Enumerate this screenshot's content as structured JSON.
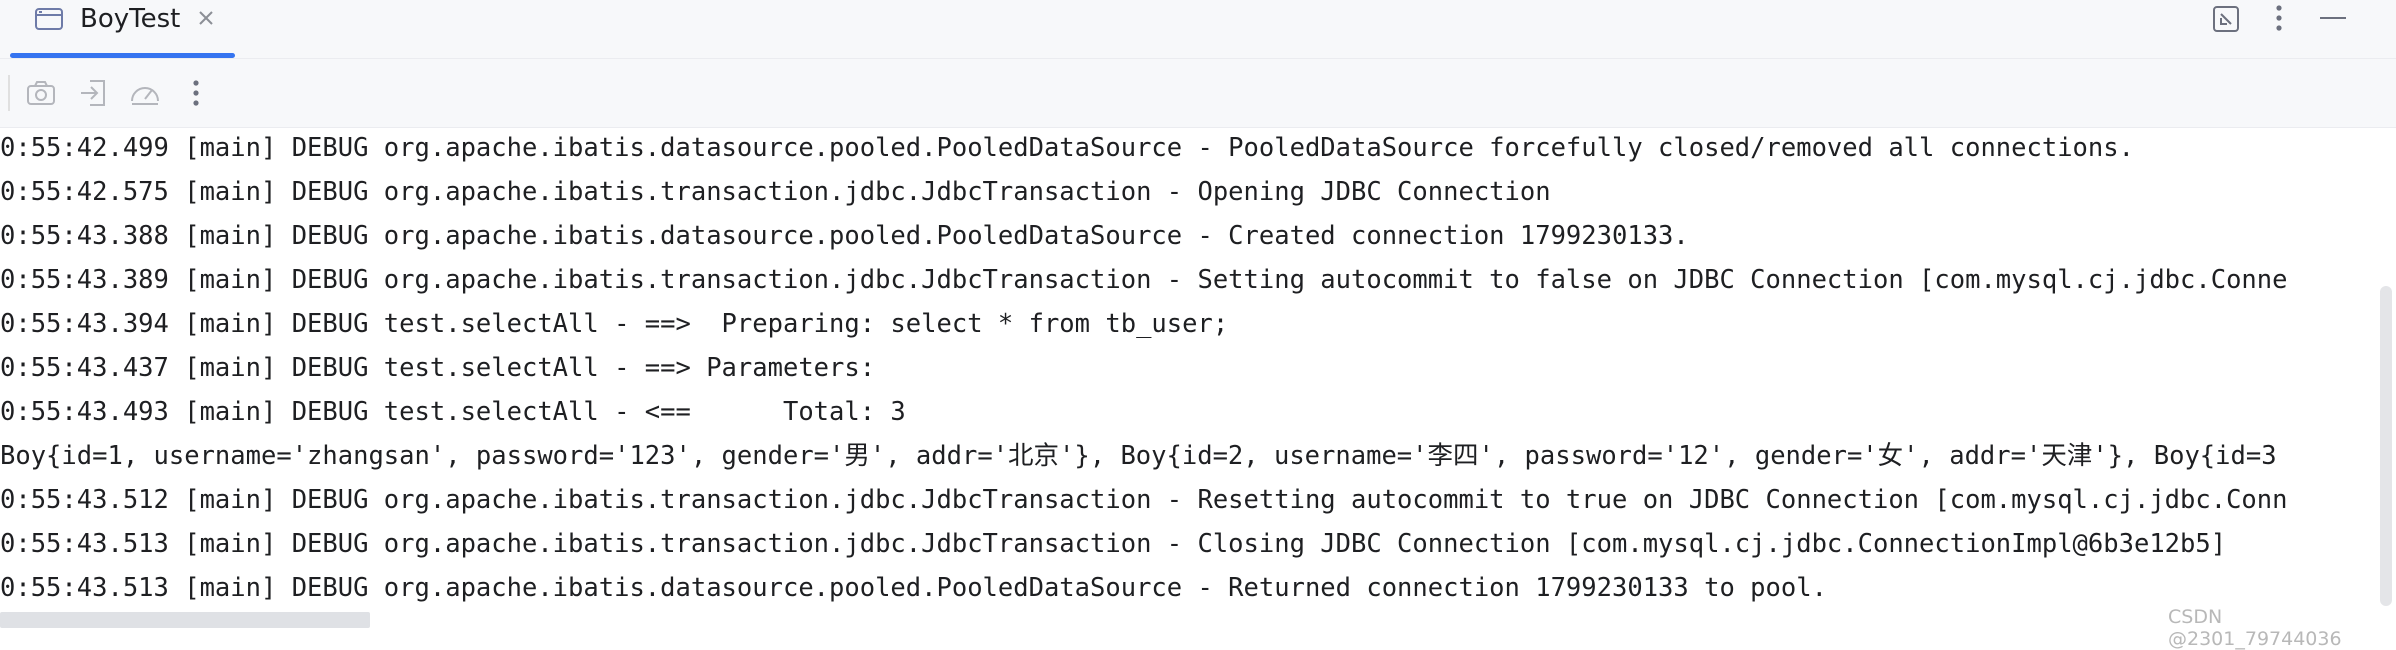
{
  "tab": {
    "title": "BoyTest"
  },
  "window_controls": [
    "restore-icon",
    "more-vertical-icon",
    "minimize-icon"
  ],
  "toolbar": {
    "icons": [
      "camera-icon",
      "import-icon",
      "gauge-icon",
      "more-vertical-icon"
    ]
  },
  "console": {
    "lines": [
      "0:55:42.499 [main] DEBUG org.apache.ibatis.datasource.pooled.PooledDataSource - PooledDataSource forcefully closed/removed all connections.",
      "0:55:42.575 [main] DEBUG org.apache.ibatis.transaction.jdbc.JdbcTransaction - Opening JDBC Connection",
      "0:55:43.388 [main] DEBUG org.apache.ibatis.datasource.pooled.PooledDataSource - Created connection 1799230133.",
      "0:55:43.389 [main] DEBUG org.apache.ibatis.transaction.jdbc.JdbcTransaction - Setting autocommit to false on JDBC Connection [com.mysql.cj.jdbc.Conne",
      "0:55:43.394 [main] DEBUG test.selectAll - ==>  Preparing: select * from tb_user;",
      "0:55:43.437 [main] DEBUG test.selectAll - ==> Parameters: ",
      "0:55:43.493 [main] DEBUG test.selectAll - <==      Total: 3",
      "Boy{id=1, username='zhangsan', password='123', gender='男', addr='北京'}, Boy{id=2, username='李四', password='12', gender='女', addr='天津'}, Boy{id=3",
      "0:55:43.512 [main] DEBUG org.apache.ibatis.transaction.jdbc.JdbcTransaction - Resetting autocommit to true on JDBC Connection [com.mysql.cj.jdbc.Conn",
      "0:55:43.513 [main] DEBUG org.apache.ibatis.transaction.jdbc.JdbcTransaction - Closing JDBC Connection [com.mysql.cj.jdbc.ConnectionImpl@6b3e12b5]",
      "0:55:43.513 [main] DEBUG org.apache.ibatis.datasource.pooled.PooledDataSource - Returned connection 1799230133 to pool."
    ]
  },
  "watermark": "CSDN @2301_79744036",
  "colors": {
    "accent": "#3574f0",
    "panel_bg": "#f7f8fa",
    "text": "#1e1f22",
    "icon": "#8c8f96"
  }
}
